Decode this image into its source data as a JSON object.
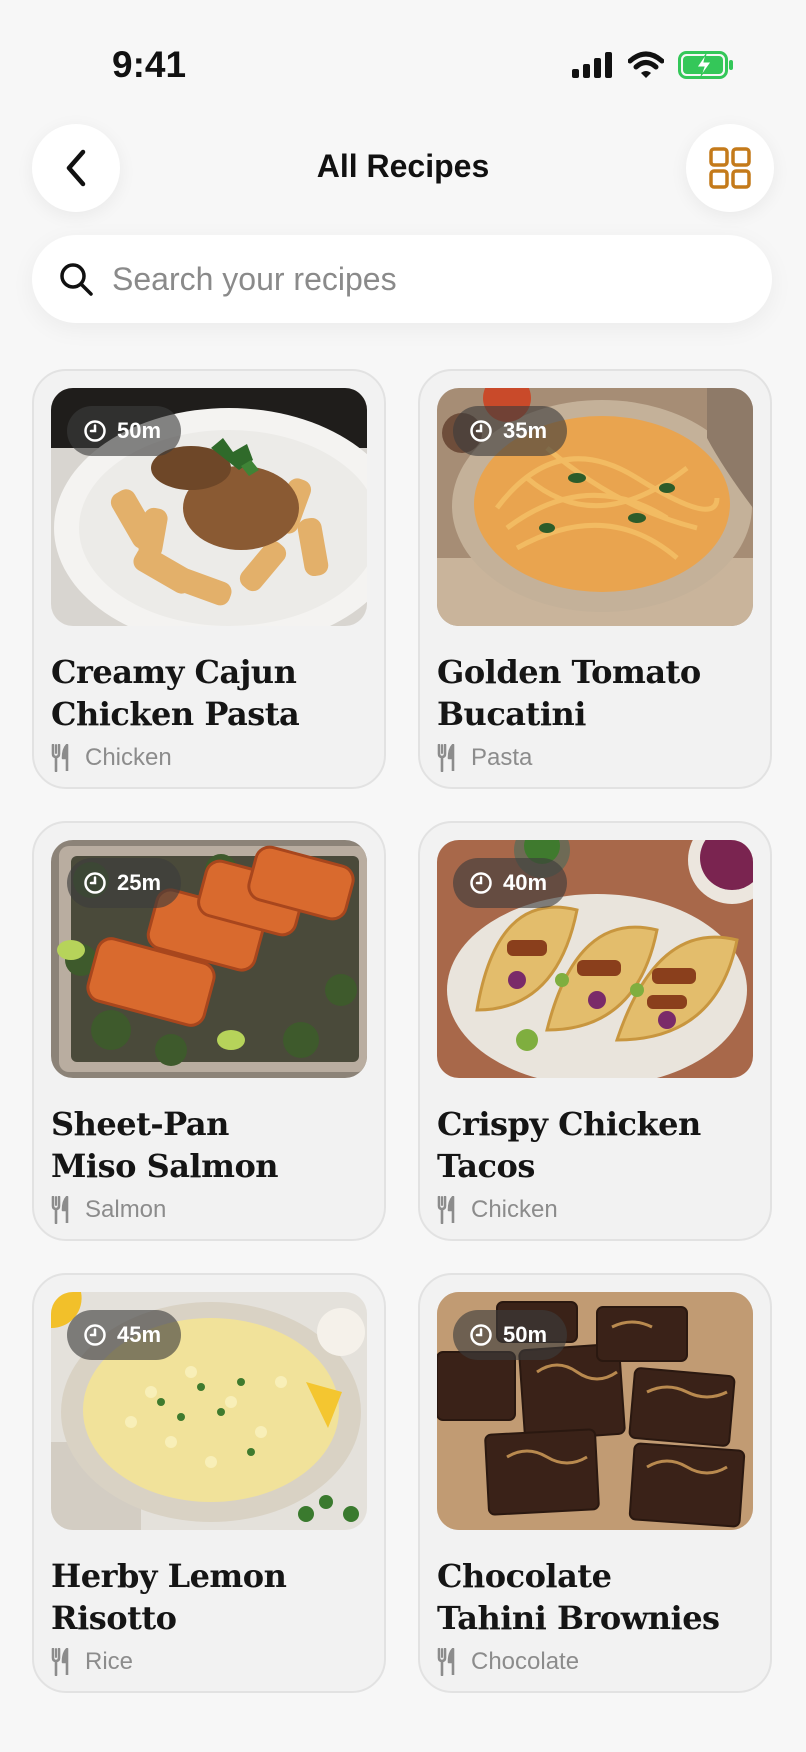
{
  "status": {
    "time": "9:41"
  },
  "header": {
    "title": "All Recipes"
  },
  "search": {
    "placeholder": "Search your recipes",
    "value": ""
  },
  "colors": {
    "accent": "#c47a1a",
    "background": "#f7f7f7",
    "card": "#f2f2f2",
    "battery": "#34c759"
  },
  "icons": {
    "back": "chevron-left-icon",
    "grid": "grid-view-icon",
    "search": "search-icon",
    "time": "clock-icon",
    "category": "fork-knife-icon"
  },
  "recipes": [
    {
      "time": "50m",
      "title_line1": "Creamy Cajun",
      "title_line2": "Chicken Pasta",
      "category": "Chicken"
    },
    {
      "time": "35m",
      "title_line1": "Golden Tomato",
      "title_line2": "Bucatini",
      "category": "Pasta"
    },
    {
      "time": "25m",
      "title_line1": "Sheet-Pan",
      "title_line2": "Miso Salmon",
      "category": "Salmon"
    },
    {
      "time": "40m",
      "title_line1": "Crispy Chicken",
      "title_line2": "Tacos",
      "category": "Chicken"
    },
    {
      "time": "45m",
      "title_line1": "Herby Lemon",
      "title_line2": "Risotto",
      "category": "Rice"
    },
    {
      "time": "50m",
      "title_line1": "Chocolate",
      "title_line2": "Tahini Brownies",
      "category": "Chocolate"
    }
  ]
}
